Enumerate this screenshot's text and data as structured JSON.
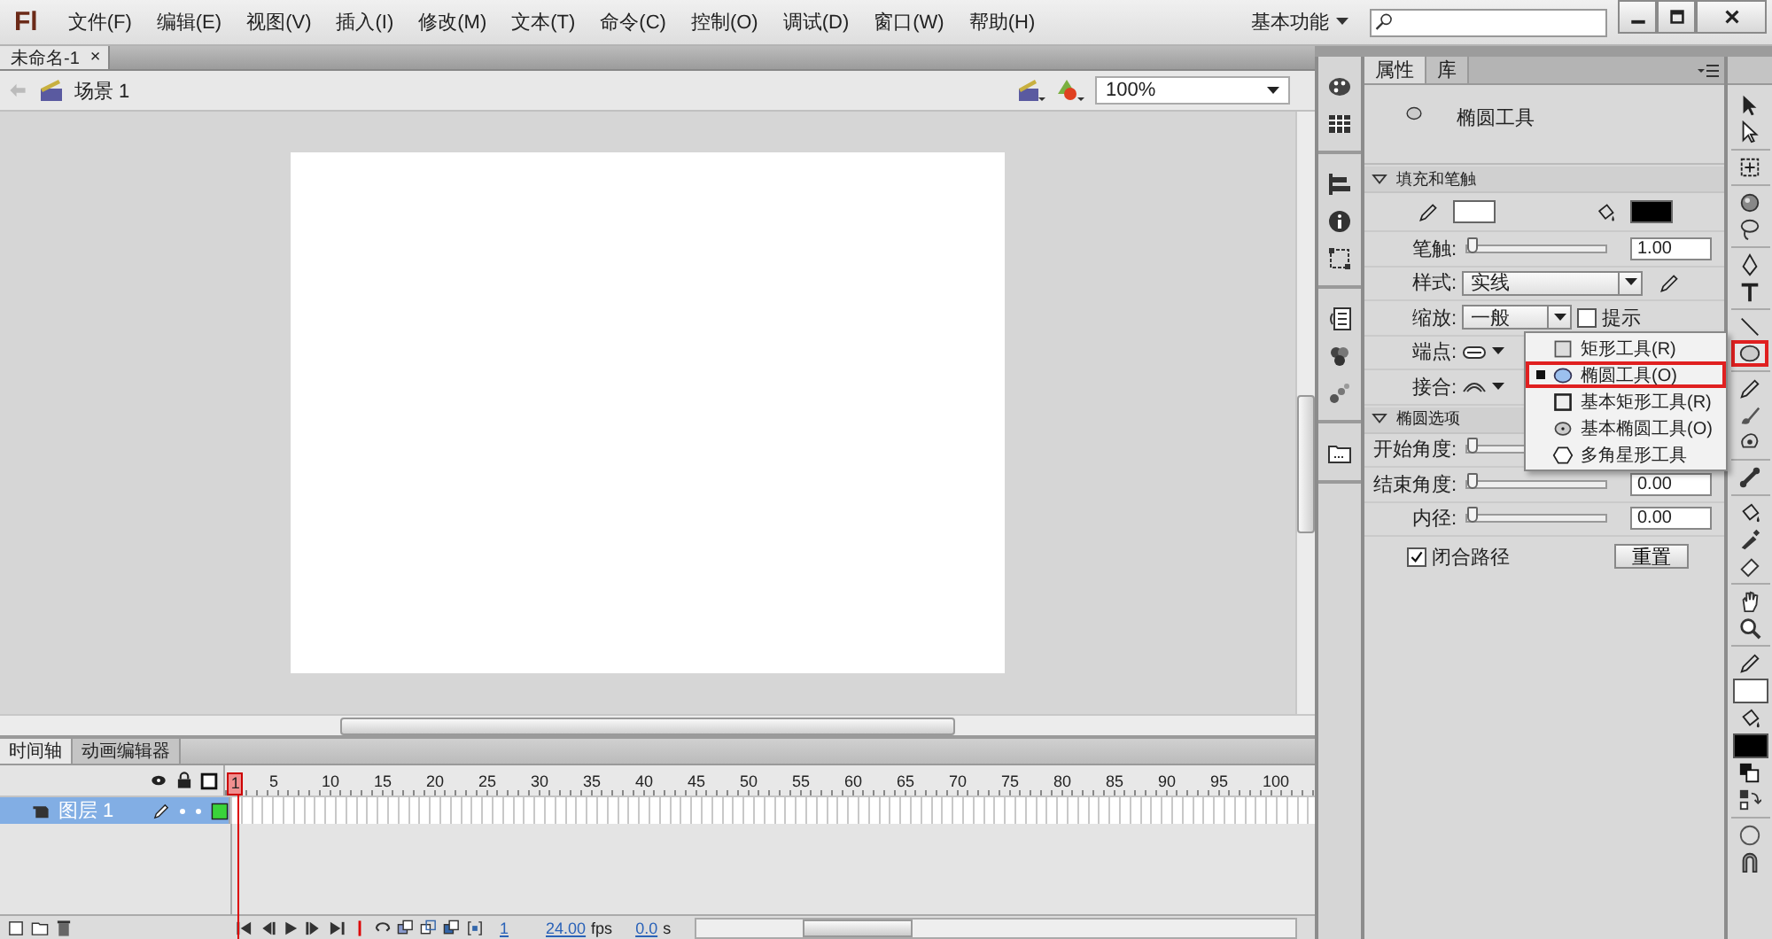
{
  "menu_bar": {
    "logo": "Fl",
    "menus": [
      "文件(F)",
      "编辑(E)",
      "视图(V)",
      "插入(I)",
      "修改(M)",
      "文本(T)",
      "命令(C)",
      "控制(O)",
      "调试(D)",
      "窗口(W)",
      "帮助(H)"
    ],
    "workspace": "基本功能"
  },
  "document": {
    "tabs": [
      {
        "label": "未命名-1",
        "close": "×",
        "selected": true
      }
    ],
    "scene": "场景 1",
    "zoom": "100%"
  },
  "timeline": {
    "tabs": [
      {
        "label": "时间轴",
        "selected": true
      },
      {
        "label": "动画编辑器",
        "selected": false
      }
    ],
    "frame_numbers": [
      "1",
      "5",
      "10",
      "15",
      "20",
      "25",
      "30",
      "35",
      "40",
      "45",
      "50",
      "55",
      "60",
      "65",
      "70",
      "75",
      "80",
      "85",
      "90",
      "95",
      "100"
    ],
    "layers": [
      {
        "name": "图层 1",
        "selected": true
      }
    ],
    "current_frame": "1",
    "frame_rate": "24.00",
    "frame_rate_unit": "fps",
    "elapsed": "0.0",
    "elapsed_unit": "s"
  },
  "properties": {
    "tabs": [
      {
        "label": "属性",
        "selected": true
      },
      {
        "label": "库",
        "selected": false
      }
    ],
    "tool_name": "椭圆工具",
    "sections": [
      {
        "title": "填充和笔触",
        "expanded": true,
        "rows": [
          {
            "kind": "colors",
            "swatches": [
              {
                "color": "#ffffff"
              },
              {
                "color": "#000000"
              }
            ]
          },
          {
            "kind": "slider",
            "label": "笔触:",
            "level": 0,
            "value": "1.00"
          },
          {
            "kind": "select",
            "label": "样式:",
            "value": "实线"
          },
          {
            "kind": "select_check",
            "label": "缩放:",
            "value": "一般",
            "check_label": "提示",
            "checked": false
          },
          {
            "kind": "cap_select",
            "label": "端点:"
          },
          {
            "kind": "join_select",
            "label": "接合:"
          }
        ]
      },
      {
        "title": "椭圆选项",
        "expanded": true,
        "rows": [
          {
            "kind": "slider",
            "label": "开始角度:",
            "level": 0
          },
          {
            "kind": "slider",
            "label": "结束角度:",
            "level": 0,
            "value": "0.00"
          },
          {
            "kind": "slider",
            "label": "内径:",
            "level": 0,
            "value": "0.00"
          },
          {
            "kind": "check_button",
            "check_label": "闭合路径",
            "checked": true,
            "button": "重置"
          }
        ]
      }
    ]
  },
  "tool_menu": {
    "items": [
      {
        "label": "矩形工具(R)",
        "selected": false
      },
      {
        "label": "椭圆工具(O)",
        "selected": true
      },
      {
        "label": "基本矩形工具(R)",
        "selected": false
      },
      {
        "label": "基本椭圆工具(O)",
        "selected": false
      },
      {
        "label": "多角星形工具",
        "selected": false
      }
    ]
  },
  "tools": [
    {
      "kind": "tool",
      "selected": false
    },
    {
      "kind": "tool",
      "selected": false
    },
    {
      "kind": "tool",
      "selected": false
    },
    {
      "kind": "tool",
      "selected": false
    },
    {
      "kind": "tool",
      "selected": false
    },
    {
      "kind": "tool",
      "selected": false
    },
    {
      "kind": "tool",
      "selected": false
    },
    {
      "kind": "tool",
      "selected": false
    },
    {
      "kind": "tool",
      "selected": true
    },
    {
      "kind": "tool",
      "selected": false
    },
    {
      "kind": "tool",
      "selected": false
    },
    {
      "kind": "tool",
      "selected": false
    },
    {
      "kind": "tool",
      "selected": false
    },
    {
      "kind": "tool",
      "selected": false
    },
    {
      "kind": "tool",
      "selected": false
    },
    {
      "kind": "tool",
      "selected": false
    },
    {
      "kind": "tool",
      "selected": false
    },
    {
      "kind": "tool",
      "selected": false
    },
    {
      "kind": "tool",
      "selected": false
    },
    {
      "kind": "swatch",
      "color": "#ffffff"
    },
    {
      "kind": "tool",
      "selected": false
    },
    {
      "kind": "swatch",
      "color": "#000000"
    },
    {
      "kind": "tool",
      "selected": false
    },
    {
      "kind": "tool",
      "selected": false
    },
    {
      "kind": "tool",
      "selected": false
    },
    {
      "kind": "tool",
      "selected": false
    }
  ]
}
